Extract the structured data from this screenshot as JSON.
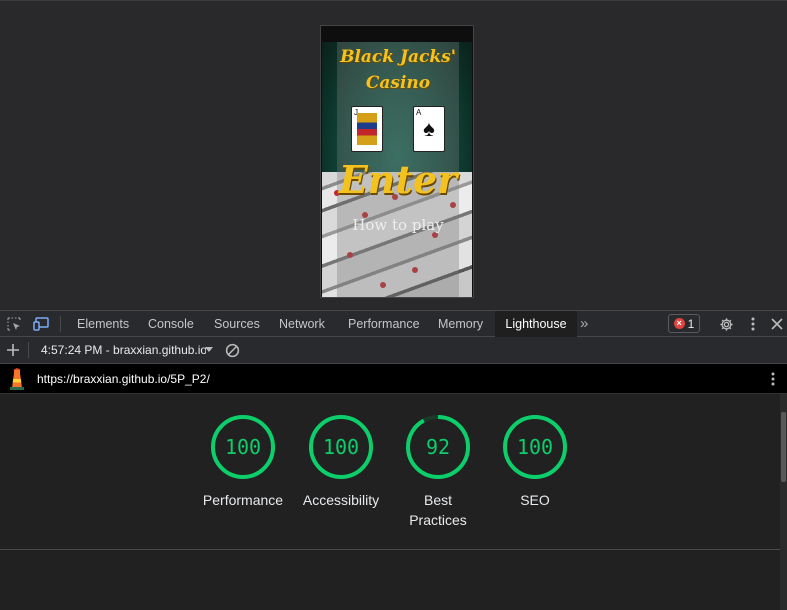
{
  "viewport": {
    "site_title_line1": "Black Jacks'",
    "site_title_line2": "Casino",
    "enter_label": "Enter",
    "howto_label": "How to play",
    "card_ace_rank": "A",
    "card_ace_suit": "♠",
    "card_jack_rank": "J"
  },
  "devtools": {
    "tabs": [
      "Elements",
      "Console",
      "Sources",
      "Network",
      "Performance",
      "Memory",
      "Lighthouse"
    ],
    "active_tab": "Lighthouse",
    "more_tabs_icon": "»",
    "error_count": "1"
  },
  "lighthouse_toolbar": {
    "report_selector": "4:57:24 PM - braxxian.github.io"
  },
  "url_bar": {
    "url": "https://braxxian.github.io/5P_P2/"
  },
  "scores": [
    {
      "label": "Performance",
      "value": 100
    },
    {
      "label": "Accessibility",
      "value": 100
    },
    {
      "label": "Best Practices",
      "value": 92
    },
    {
      "label": "SEO",
      "value": 100
    }
  ],
  "colors": {
    "score_good": "#0cce6b",
    "score_track": "#1c3a2a"
  }
}
